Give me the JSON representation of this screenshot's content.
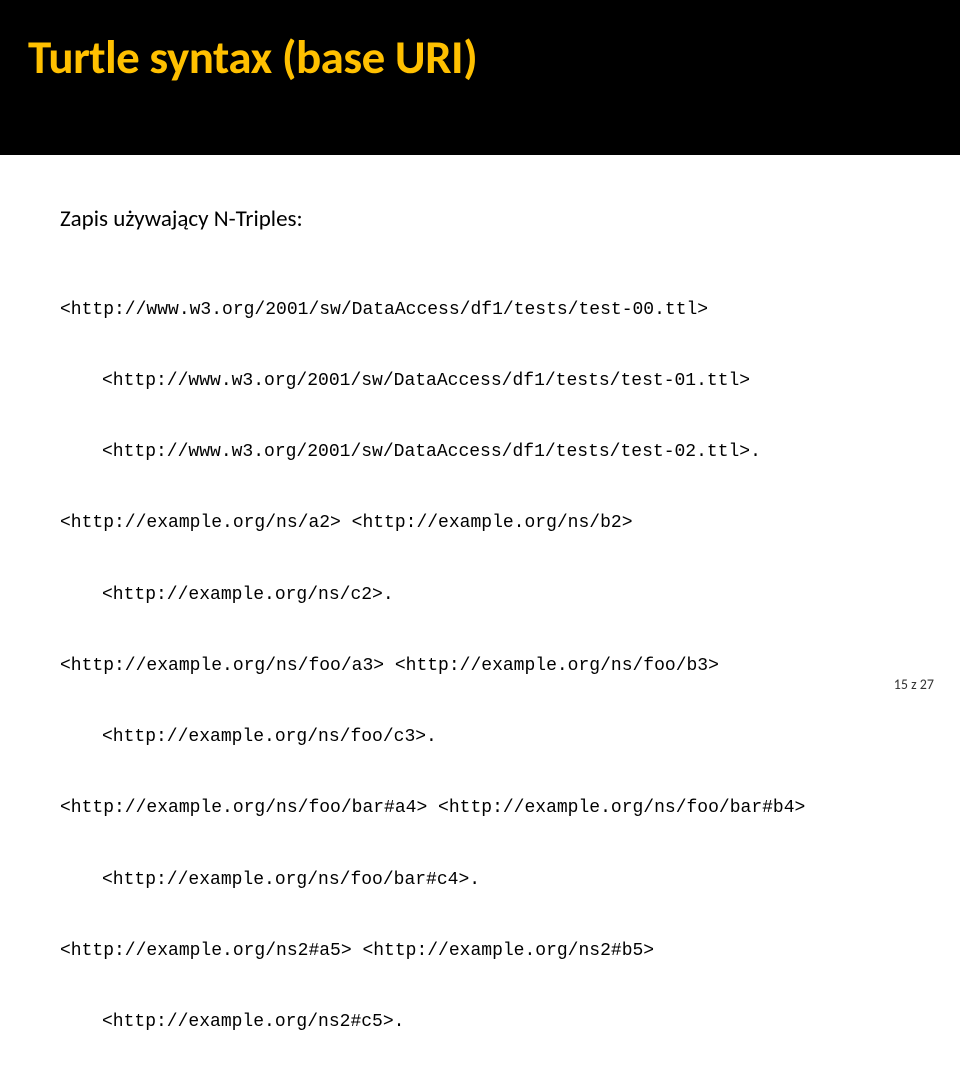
{
  "header": {
    "title": "Turtle syntax (base URI)"
  },
  "content": {
    "subtitle": "Zapis używający  N-Triples:",
    "lines": [
      {
        "indent": 0,
        "text": "<http://www.w3.org/2001/sw/DataAccess/df1/tests/test-00.ttl>"
      },
      {
        "indent": 1,
        "text": "<http://www.w3.org/2001/sw/DataAccess/df1/tests/test-01.ttl>"
      },
      {
        "indent": 1,
        "text": "<http://www.w3.org/2001/sw/DataAccess/df1/tests/test-02.ttl>."
      },
      {
        "indent": 0,
        "text": "<http://example.org/ns/a2> <http://example.org/ns/b2>"
      },
      {
        "indent": 1,
        "text": "<http://example.org/ns/c2>."
      },
      {
        "indent": 0,
        "text": "<http://example.org/ns/foo/a3> <http://example.org/ns/foo/b3>"
      },
      {
        "indent": 1,
        "text": "<http://example.org/ns/foo/c3>."
      },
      {
        "indent": 0,
        "text": "<http://example.org/ns/foo/bar#a4> <http://example.org/ns/foo/bar#b4>"
      },
      {
        "indent": 1,
        "text": "<http://example.org/ns/foo/bar#c4>."
      },
      {
        "indent": 0,
        "text": "<http://example.org/ns2#a5> <http://example.org/ns2#b5>"
      },
      {
        "indent": 1,
        "text": "<http://example.org/ns2#c5>."
      }
    ]
  },
  "footer": {
    "page": "15 z 27"
  }
}
